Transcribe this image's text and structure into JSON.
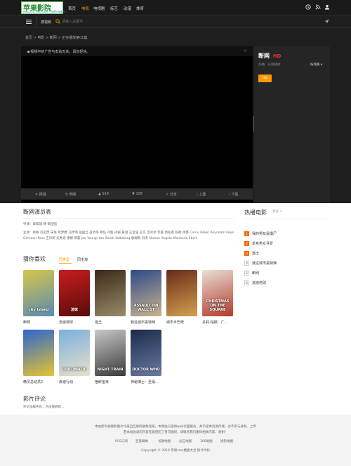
{
  "header": {
    "logo_text": "苹果影院",
    "logo_sub": "PINGGUO YINGYUAN · 好看的电影网",
    "nav": [
      "首页",
      "电影",
      "电视剧",
      "综艺",
      "动漫",
      "体育"
    ],
    "active_nav": 1
  },
  "search": {
    "category_label": "搜视频",
    "placeholder": "请输入关键字"
  },
  "breadcrumb": "首页 > 电影 > 断网 > 正在播放第01集",
  "player": {
    "notice": "◀ 视频中的广告与本站无关，请勿轻信。",
    "controls": [
      "报错",
      "刷新",
      "919",
      "108",
      "分享",
      "上集",
      "下集"
    ]
  },
  "info": {
    "title": "断网",
    "badge": "HD",
    "source_label": "热播：在线播放",
    "sort_label": "按线路",
    "episode": "HD"
  },
  "cast": {
    "heading": "断网演员表",
    "director": "导演：章家瑞-韩·蔡国强",
    "actors": "主演：徐峥 刘昊然 朱珠 蒋梦婕 马伊琍 张国立 苗侨伟 郑恺 邓超 孙俪 黄渤 王宝强 吴京 范冰冰 李晨 周冬雨 陈赫 杨幂 Carrie Baker Reynolds Hope Glendon-Ross 王珍妮 吴秀波 谢娜 黄磊 Jee Young Han Sarah Saltzberg 詹姆斯 刘涛 Sharon Angela Marianne Ebert"
  },
  "guess": {
    "heading": "猜你喜欢",
    "tabs": [
      "同类型",
      "同主演"
    ],
    "items": [
      {
        "title": "断网",
        "poster_text": "city island",
        "colors": [
          "#d7c64a",
          "#5a8bb0"
        ]
      },
      {
        "title": "流浪地球",
        "poster_text": "波妹",
        "colors": [
          "#c81e1e",
          "#5a0a0a"
        ]
      },
      {
        "title": "渔王",
        "poster_text": "",
        "colors": [
          "#3a2a1a",
          "#9a8a6a"
        ]
      },
      {
        "title": "我这城市黑特辣",
        "poster_text": "ASSAULT ON WALL ST",
        "colors": [
          "#2d4a8a",
          "#c9b48a"
        ]
      },
      {
        "title": "城市乡巴佬",
        "poster_text": "",
        "colors": [
          "#6a2a18",
          "#d2a050"
        ]
      },
      {
        "title": "多莉·帕顿：广...",
        "poster_text": "CHRISTMAS ON THE SQUARE",
        "colors": [
          "#e8e0d8",
          "#b53a2a"
        ]
      },
      {
        "title": "精灵总动员2",
        "poster_text": "",
        "colors": [
          "#2a66d0",
          "#e8c430"
        ]
      },
      {
        "title": "疾速行动",
        "poster_text": "DIPLOMATIC",
        "colors": [
          "#7ab0e0",
          "#e8e0c8"
        ]
      },
      {
        "title": "宿醉金目",
        "poster_text": "NIGHT TRAIN",
        "colors": [
          "#c8c8c8",
          "#3a3a3a"
        ]
      },
      {
        "title": "神秘博士：圣诞...",
        "poster_text": "DOCTOR WHO",
        "colors": [
          "#1a2a4a",
          "#6a7aa0"
        ]
      }
    ]
  },
  "hot": {
    "heading": "热播电影",
    "more": "更多 >",
    "items": [
      "我的男友是僵尸",
      "单身男女寻爱",
      "渔王",
      "我这城市黑特辣",
      "断网",
      "流浪地球"
    ]
  },
  "comments": {
    "heading": "影片评论",
    "text": "评论加载失败，点击我刷新..."
  },
  "footer": {
    "line1": "本站所有视频和图片均来自互联网收集而来，本网站只提供web页面服务，并不提供资源存储，也不参与录制、上传",
    "line2": "若本站收录的内容无意侵犯了贵司版权，请联系我们删除相关内容，谢谢！",
    "links": [
      "RSS订阅",
      "百度蜘蛛",
      "谷歌地图",
      "必应地图",
      "360地图",
      "搜狗地图"
    ],
    "copyright": "Copyright © 2019 苹果cms模板大全 统计代码"
  }
}
